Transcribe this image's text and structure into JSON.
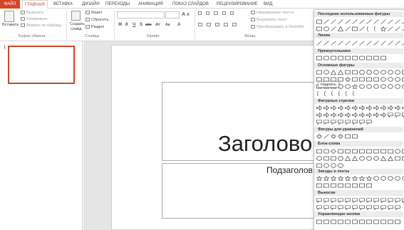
{
  "tabs": [
    "ФАЙЛ",
    "ГЛАВНАЯ",
    "ВСТАВКА",
    "ДИЗАЙН",
    "ПЕРЕХОДЫ",
    "АНИМАЦИЯ",
    "ПОКАЗ СЛАЙДОВ",
    "РЕЦЕНЗИРОВАНИЕ",
    "ВИД"
  ],
  "ribbon": {
    "clipboard": {
      "paste": "Вставить",
      "cut": "Вырезать",
      "copy": "Копировать",
      "format_painter": "Формат по образцу",
      "group": "Буфер обмена"
    },
    "slides": {
      "new_slide_l1": "Создать",
      "new_slide_l2": "слайд",
      "layout": "Макет",
      "reset": "Сбросить",
      "section": "Раздел",
      "group": "Слайды"
    },
    "font": {
      "group": "Шрифт",
      "bold": "Ж",
      "italic": "К",
      "underline": "Ч",
      "strike": "S",
      "abc": "abc",
      "aa": "Aa",
      "a": "A"
    },
    "paragraph": {
      "group": "Абзац",
      "text_direction": "Направление текста",
      "align_text": "Выровнять текст",
      "smartart": "Преобразовать в SmartArt"
    }
  },
  "thumbs": {
    "slide_number": "1"
  },
  "slide": {
    "title": "Заголово",
    "subtitle": "Подзаголов"
  },
  "gallery": {
    "sections": {
      "recent": "Последние использованные фигуры",
      "lines": "Линии",
      "rectangles": "Прямоугольники",
      "basic": "Основные фигуры",
      "arrows": "Фигурные стрелки",
      "equation": "Фигуры для уравнений",
      "flowchart": "Блок-схема",
      "stars": "Звезды и ленты",
      "callouts": "Выноски",
      "action": "Управляющие кнопки"
    },
    "tooltip": "Надпись"
  }
}
